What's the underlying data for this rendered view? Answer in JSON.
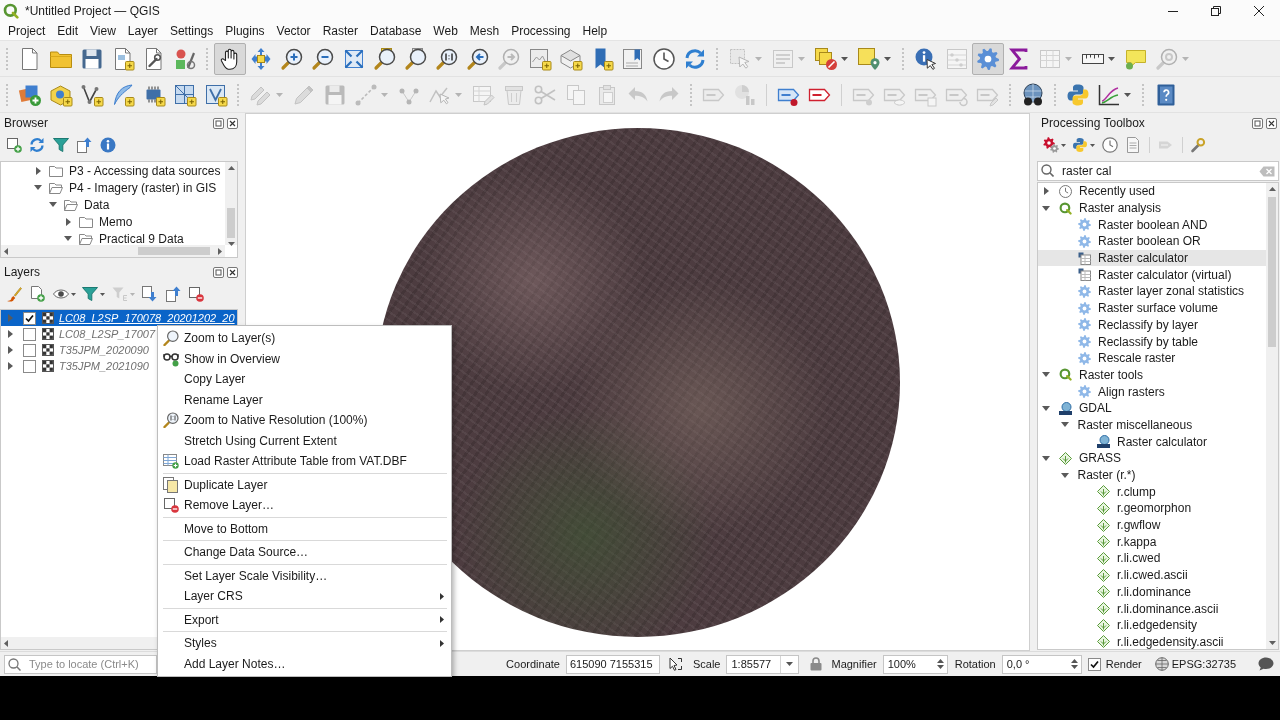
{
  "window": {
    "title": "*Untitled Project — QGIS"
  },
  "menu_bar": [
    "Project",
    "Edit",
    "View",
    "Layer",
    "Settings",
    "Plugins",
    "Vector",
    "Raster",
    "Database",
    "Web",
    "Mesh",
    "Processing",
    "Help"
  ],
  "toolbar_1": [
    {
      "selected": false,
      "disabled": false
    },
    {
      "selected": false,
      "disabled": false
    },
    {
      "selected": false,
      "disabled": false
    },
    {
      "selected": false,
      "disabled": false
    },
    {
      "selected": false,
      "disabled": false
    },
    {
      "selected": false,
      "disabled": false
    },
    {
      "selected": true,
      "disabled": false
    },
    {
      "selected": false,
      "disabled": false
    },
    {
      "selected": false,
      "disabled": false
    },
    {
      "selected": false,
      "disabled": false
    },
    {
      "selected": false,
      "disabled": false
    },
    {
      "selected": false,
      "disabled": false
    },
    {
      "selected": false,
      "disabled": false
    },
    {
      "selected": false,
      "disabled": false
    },
    {
      "selected": false,
      "disabled": false
    },
    {
      "selected": false,
      "disabled": true
    },
    {
      "selected": false,
      "disabled": false
    },
    {
      "selected": false,
      "disabled": false
    },
    {
      "selected": false,
      "disabled": false
    },
    {
      "selected": false,
      "disabled": false
    },
    {
      "selected": false,
      "disabled": false
    },
    {
      "selected": false,
      "disabled": false
    },
    {
      "selected": false,
      "disabled": true
    },
    {
      "selected": false,
      "disabled": true
    },
    {
      "selected": false,
      "disabled": false
    },
    {
      "selected": false,
      "disabled": false
    },
    {
      "selected": false,
      "disabled": false
    },
    {
      "selected": false,
      "disabled": true
    },
    {
      "selected": true,
      "disabled": false
    },
    {
      "selected": false,
      "disabled": false
    },
    {
      "selected": false,
      "disabled": true
    },
    {
      "selected": false,
      "disabled": false
    },
    {
      "selected": false,
      "disabled": false
    },
    {
      "selected": false,
      "disabled": true
    }
  ],
  "toolbar_2": [
    {
      "selected": false,
      "disabled": false
    },
    {
      "selected": false,
      "disabled": false
    },
    {
      "selected": false,
      "disabled": false
    },
    {
      "selected": false,
      "disabled": false
    },
    {
      "selected": false,
      "disabled": false
    },
    {
      "selected": false,
      "disabled": false
    },
    {
      "selected": false,
      "disabled": false
    },
    {
      "selected": false,
      "disabled": true
    },
    {
      "selected": false,
      "disabled": true
    },
    {
      "selected": false,
      "disabled": true
    },
    {
      "selected": false,
      "disabled": true
    },
    {
      "selected": false,
      "disabled": true
    },
    {
      "selected": false,
      "disabled": true
    },
    {
      "selected": false,
      "disabled": true
    },
    {
      "selected": false,
      "disabled": true
    },
    {
      "selected": false,
      "disabled": true
    },
    {
      "selected": false,
      "disabled": true
    },
    {
      "selected": false,
      "disabled": true
    },
    {
      "selected": false,
      "disabled": true
    },
    {
      "selected": false,
      "disabled": true
    },
    {
      "selected": false,
      "disabled": true
    },
    {
      "selected": false,
      "disabled": true
    },
    {
      "selected": false,
      "disabled": false
    },
    {
      "selected": false,
      "disabled": false
    },
    {
      "selected": false,
      "disabled": true
    },
    {
      "selected": false,
      "disabled": true
    },
    {
      "selected": false,
      "disabled": true
    },
    {
      "selected": false,
      "disabled": true
    },
    {
      "selected": false,
      "disabled": true
    },
    {
      "selected": false,
      "disabled": false
    },
    {
      "selected": false,
      "disabled": false
    },
    {
      "selected": false,
      "disabled": false
    },
    {
      "selected": false,
      "disabled": false
    }
  ],
  "browser_panel": {
    "title": "Browser",
    "toolbar": [
      {
        "disabled": false
      },
      {
        "disabled": false
      },
      {
        "disabled": false
      },
      {
        "disabled": false
      },
      {
        "disabled": false
      }
    ],
    "tree": [
      {
        "label": "P3 - Accessing data sources",
        "expanded": false
      },
      {
        "label": "P4 - Imagery (raster) in GIS",
        "expanded": true,
        "children": [
          {
            "label": "Data",
            "expanded": true,
            "children": [
              {
                "label": "Memo",
                "expanded": false
              },
              {
                "label": "Practical 9 Data",
                "expanded": true
              }
            ]
          }
        ]
      }
    ]
  },
  "layers_panel": {
    "title": "Layers",
    "toolbar": [
      {
        "disabled": false
      },
      {
        "disabled": false
      },
      {
        "disabled": false
      },
      {
        "disabled": false
      },
      {
        "disabled": true
      },
      {
        "disabled": false
      },
      {
        "disabled": false
      },
      {
        "disabled": false
      }
    ],
    "layers": [
      {
        "name": "LC08_L2SP_170078_20201202_20",
        "checked": true,
        "selected": true,
        "expanded": false
      },
      {
        "name": "LC08_L2SP_17007",
        "checked": false,
        "selected": false,
        "expanded": false
      },
      {
        "name": "T35JPM_2020090",
        "checked": false,
        "selected": false,
        "expanded": false
      },
      {
        "name": "T35JPM_2021090",
        "checked": false,
        "selected": false,
        "expanded": false
      }
    ]
  },
  "processing_toolbox": {
    "title": "Processing Toolbox",
    "toolbar": [
      {
        "disabled": false
      },
      {
        "disabled": false
      },
      {
        "disabled": false
      },
      {
        "disabled": false
      },
      {
        "disabled": true
      },
      {
        "disabled": false
      }
    ],
    "search": {
      "value": "raster cal"
    },
    "tree": [
      {
        "label": "Recently used",
        "kind": "recent",
        "expanded": false,
        "selected": false
      },
      {
        "label": "Raster analysis",
        "kind": "provider_qgis",
        "expanded": true,
        "selected": false,
        "children": [
          {
            "label": "Raster boolean AND",
            "kind": "algorithm",
            "selected": false
          },
          {
            "label": "Raster boolean OR",
            "kind": "algorithm",
            "selected": false
          },
          {
            "label": "Raster calculator",
            "kind": "algorithm_calc",
            "selected": true
          },
          {
            "label": "Raster calculator (virtual)",
            "kind": "algorithm_calc",
            "selected": false
          },
          {
            "label": "Raster layer zonal statistics",
            "kind": "algorithm",
            "selected": false
          },
          {
            "label": "Raster surface volume",
            "kind": "algorithm",
            "selected": false
          },
          {
            "label": "Reclassify by layer",
            "kind": "algorithm",
            "selected": false
          },
          {
            "label": "Reclassify by table",
            "kind": "algorithm",
            "selected": false
          },
          {
            "label": "Rescale raster",
            "kind": "algorithm",
            "selected": false
          }
        ]
      },
      {
        "label": "Raster tools",
        "kind": "provider_qgis",
        "expanded": true,
        "selected": false,
        "children": [
          {
            "label": "Align rasters",
            "kind": "algorithm",
            "selected": false
          }
        ]
      },
      {
        "label": "GDAL",
        "kind": "provider_gdal",
        "expanded": true,
        "selected": false,
        "children": [
          {
            "label": "Raster miscellaneous",
            "kind": "group",
            "expanded": true,
            "selected": false,
            "children": [
              {
                "label": "Raster calculator",
                "kind": "algorithm_gdal",
                "selected": false
              }
            ]
          }
        ]
      },
      {
        "label": "GRASS",
        "kind": "provider_grass",
        "expanded": true,
        "selected": false,
        "children": [
          {
            "label": "Raster (r.*)",
            "kind": "group",
            "expanded": true,
            "selected": false,
            "children": [
              {
                "label": "r.clump",
                "kind": "algorithm_grass",
                "selected": false
              },
              {
                "label": "r.geomorphon",
                "kind": "algorithm_grass",
                "selected": false
              },
              {
                "label": "r.gwflow",
                "kind": "algorithm_grass",
                "selected": false
              },
              {
                "label": "r.kappa",
                "kind": "algorithm_grass",
                "selected": false
              },
              {
                "label": "r.li.cwed",
                "kind": "algorithm_grass",
                "selected": false
              },
              {
                "label": "r.li.cwed.ascii",
                "kind": "algorithm_grass",
                "selected": false
              },
              {
                "label": "r.li.dominance",
                "kind": "algorithm_grass",
                "selected": false
              },
              {
                "label": "r.li.dominance.ascii",
                "kind": "algorithm_grass",
                "selected": false
              },
              {
                "label": "r.li.edgedensity",
                "kind": "algorithm_grass",
                "selected": false
              },
              {
                "label": "r.li.edgedensity.ascii",
                "kind": "algorithm_grass",
                "selected": false
              }
            ]
          }
        ]
      }
    ]
  },
  "context_menu": {
    "sections": [
      [
        {
          "label": "Zoom to Layer(s)",
          "submenu": false
        },
        {
          "label": "Show in Overview",
          "submenu": false
        },
        {
          "label": "Copy Layer",
          "submenu": false
        },
        {
          "label": "Rename Layer",
          "submenu": false
        },
        {
          "label": "Zoom to Native Resolution (100%)",
          "submenu": false
        },
        {
          "label": "Stretch Using Current Extent",
          "submenu": false
        },
        {
          "label": "Load Raster Attribute Table from VAT.DBF",
          "submenu": false
        }
      ],
      [
        {
          "label": "Duplicate Layer",
          "submenu": false
        },
        {
          "label": "Remove Layer…",
          "submenu": false
        }
      ],
      [
        {
          "label": "Move to Bottom",
          "submenu": false
        }
      ],
      [
        {
          "label": "Change Data Source…",
          "submenu": false
        }
      ],
      [
        {
          "label": "Set Layer Scale Visibility…",
          "submenu": false
        },
        {
          "label": "Layer CRS",
          "submenu": true
        }
      ],
      [
        {
          "label": "Export",
          "submenu": true
        }
      ],
      [
        {
          "label": "Styles",
          "submenu": true
        },
        {
          "label": "Add Layer Notes…",
          "submenu": false
        }
      ]
    ]
  },
  "status_bar": {
    "locator": {
      "placeholder": "Type to locate (Ctrl+K)"
    },
    "coordinate": {
      "label": "Coordinate",
      "value": "615090 7155315"
    },
    "scale": {
      "label": "Scale",
      "value": "1:85577"
    },
    "magnifier": {
      "label": "Magnifier",
      "value": "100%"
    },
    "rotation": {
      "label": "Rotation",
      "value": "0,0 °"
    },
    "render": {
      "label": "Render",
      "checked": true
    },
    "crs": "EPSG:32735"
  }
}
